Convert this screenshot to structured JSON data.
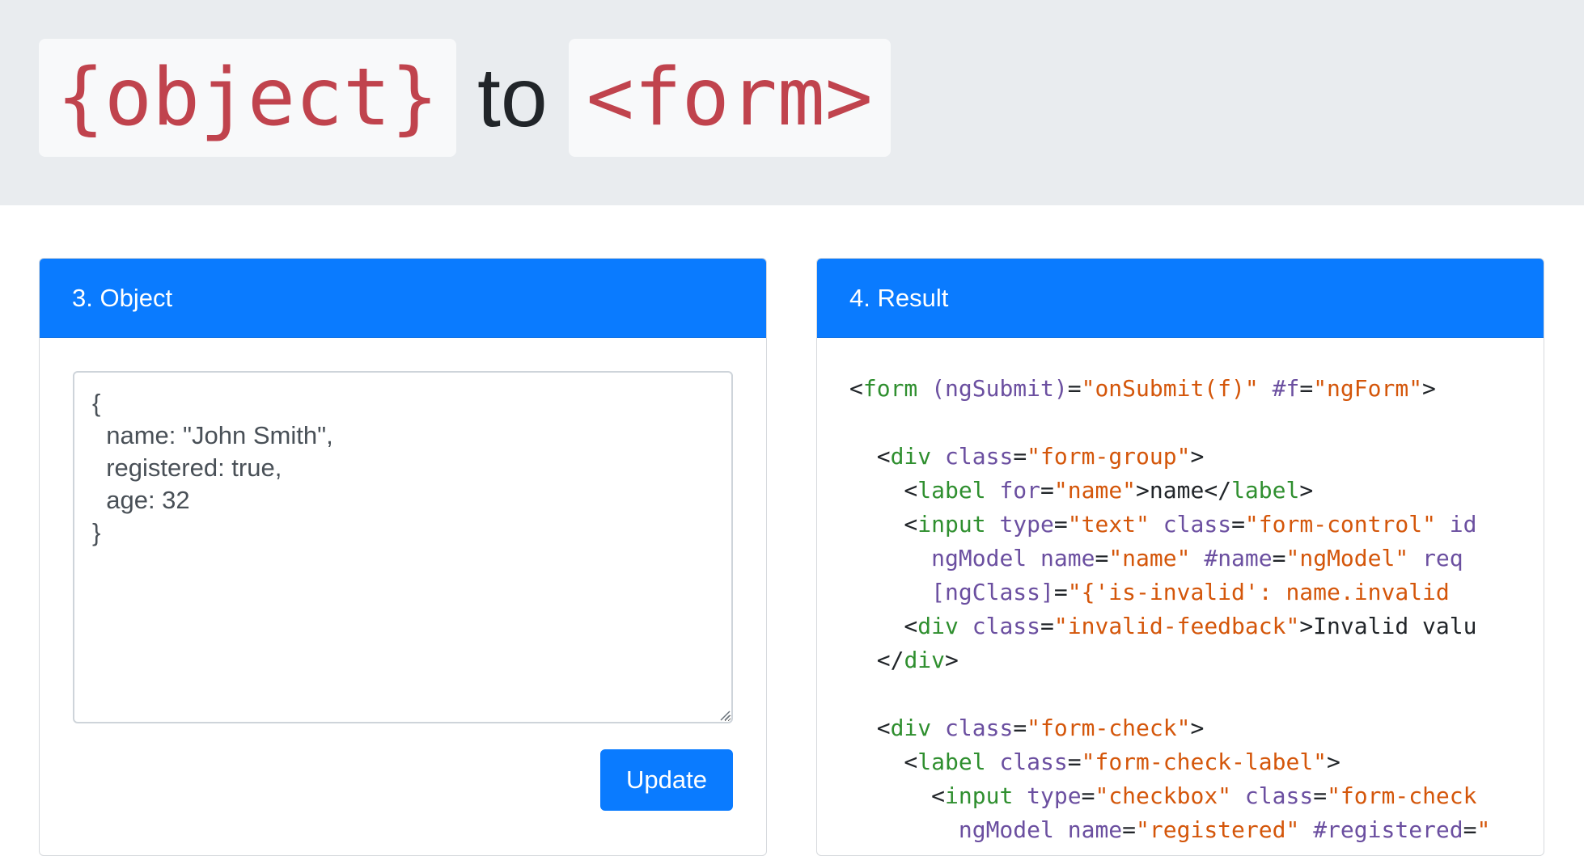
{
  "hero": {
    "left_chip": "{object}",
    "joiner": "to",
    "right_chip": "<form>"
  },
  "object_card": {
    "header": "3. Object",
    "textarea_value": "{\n  name: \"John Smith\",\n  registered: true,\n  age: 32\n}",
    "button_label": "Update"
  },
  "result_card": {
    "header": "4. Result",
    "code_lines": [
      [
        [
          "t",
          "<"
        ],
        [
          "tag",
          "form"
        ],
        [
          "t",
          " "
        ],
        [
          "attr",
          "(ngSubmit)"
        ],
        [
          "t",
          "="
        ],
        [
          "str",
          "\"onSubmit(f)\""
        ],
        [
          "t",
          " "
        ],
        [
          "attr",
          "#f"
        ],
        [
          "t",
          "="
        ],
        [
          "str",
          "\"ngForm\""
        ],
        [
          "t",
          ">"
        ]
      ],
      [],
      [
        [
          "t",
          "  <"
        ],
        [
          "tag",
          "div"
        ],
        [
          "t",
          " "
        ],
        [
          "attr",
          "class"
        ],
        [
          "t",
          "="
        ],
        [
          "str",
          "\"form-group\""
        ],
        [
          "t",
          ">"
        ]
      ],
      [
        [
          "t",
          "    <"
        ],
        [
          "tag",
          "label"
        ],
        [
          "t",
          " "
        ],
        [
          "attr",
          "for"
        ],
        [
          "t",
          "="
        ],
        [
          "str",
          "\"name\""
        ],
        [
          "t",
          ">name</"
        ],
        [
          "tag",
          "label"
        ],
        [
          "t",
          ">"
        ]
      ],
      [
        [
          "t",
          "    <"
        ],
        [
          "tag",
          "input"
        ],
        [
          "t",
          " "
        ],
        [
          "attr",
          "type"
        ],
        [
          "t",
          "="
        ],
        [
          "str",
          "\"text\""
        ],
        [
          "t",
          " "
        ],
        [
          "attr",
          "class"
        ],
        [
          "t",
          "="
        ],
        [
          "str",
          "\"form-control\""
        ],
        [
          "t",
          " "
        ],
        [
          "attr",
          "id"
        ]
      ],
      [
        [
          "t",
          "      "
        ],
        [
          "attr",
          "ngModel"
        ],
        [
          "t",
          " "
        ],
        [
          "attr",
          "name"
        ],
        [
          "t",
          "="
        ],
        [
          "str",
          "\"name\""
        ],
        [
          "t",
          " "
        ],
        [
          "attr",
          "#name"
        ],
        [
          "t",
          "="
        ],
        [
          "str",
          "\"ngModel\""
        ],
        [
          "t",
          " "
        ],
        [
          "attr",
          "req"
        ]
      ],
      [
        [
          "t",
          "      "
        ],
        [
          "attr",
          "[ngClass]"
        ],
        [
          "t",
          "="
        ],
        [
          "str",
          "\"{'is-invalid': name.invalid"
        ]
      ],
      [
        [
          "t",
          "    <"
        ],
        [
          "tag",
          "div"
        ],
        [
          "t",
          " "
        ],
        [
          "attr",
          "class"
        ],
        [
          "t",
          "="
        ],
        [
          "str",
          "\"invalid-feedback\""
        ],
        [
          "t",
          ">Invalid valu"
        ]
      ],
      [
        [
          "t",
          "  </"
        ],
        [
          "tag",
          "div"
        ],
        [
          "t",
          ">"
        ]
      ],
      [],
      [
        [
          "t",
          "  <"
        ],
        [
          "tag",
          "div"
        ],
        [
          "t",
          " "
        ],
        [
          "attr",
          "class"
        ],
        [
          "t",
          "="
        ],
        [
          "str",
          "\"form-check\""
        ],
        [
          "t",
          ">"
        ]
      ],
      [
        [
          "t",
          "    <"
        ],
        [
          "tag",
          "label"
        ],
        [
          "t",
          " "
        ],
        [
          "attr",
          "class"
        ],
        [
          "t",
          "="
        ],
        [
          "str",
          "\"form-check-label\""
        ],
        [
          "t",
          ">"
        ]
      ],
      [
        [
          "t",
          "      <"
        ],
        [
          "tag",
          "input"
        ],
        [
          "t",
          " "
        ],
        [
          "attr",
          "type"
        ],
        [
          "t",
          "="
        ],
        [
          "str",
          "\"checkbox\""
        ],
        [
          "t",
          " "
        ],
        [
          "attr",
          "class"
        ],
        [
          "t",
          "="
        ],
        [
          "str",
          "\"form-check"
        ]
      ],
      [
        [
          "t",
          "        "
        ],
        [
          "attr",
          "ngModel"
        ],
        [
          "t",
          " "
        ],
        [
          "attr",
          "name"
        ],
        [
          "t",
          "="
        ],
        [
          "str",
          "\"registered\""
        ],
        [
          "t",
          " "
        ],
        [
          "attr",
          "#registered"
        ],
        [
          "t",
          "="
        ],
        [
          "str",
          "\""
        ]
      ]
    ]
  },
  "colors": {
    "primary": "#0a7bff",
    "jumbotron_bg": "#e9ecef",
    "chip_text": "#c0434d",
    "code_tag": "#2f8f2f",
    "code_attr": "#6b4fa0",
    "code_string": "#d4560a"
  }
}
